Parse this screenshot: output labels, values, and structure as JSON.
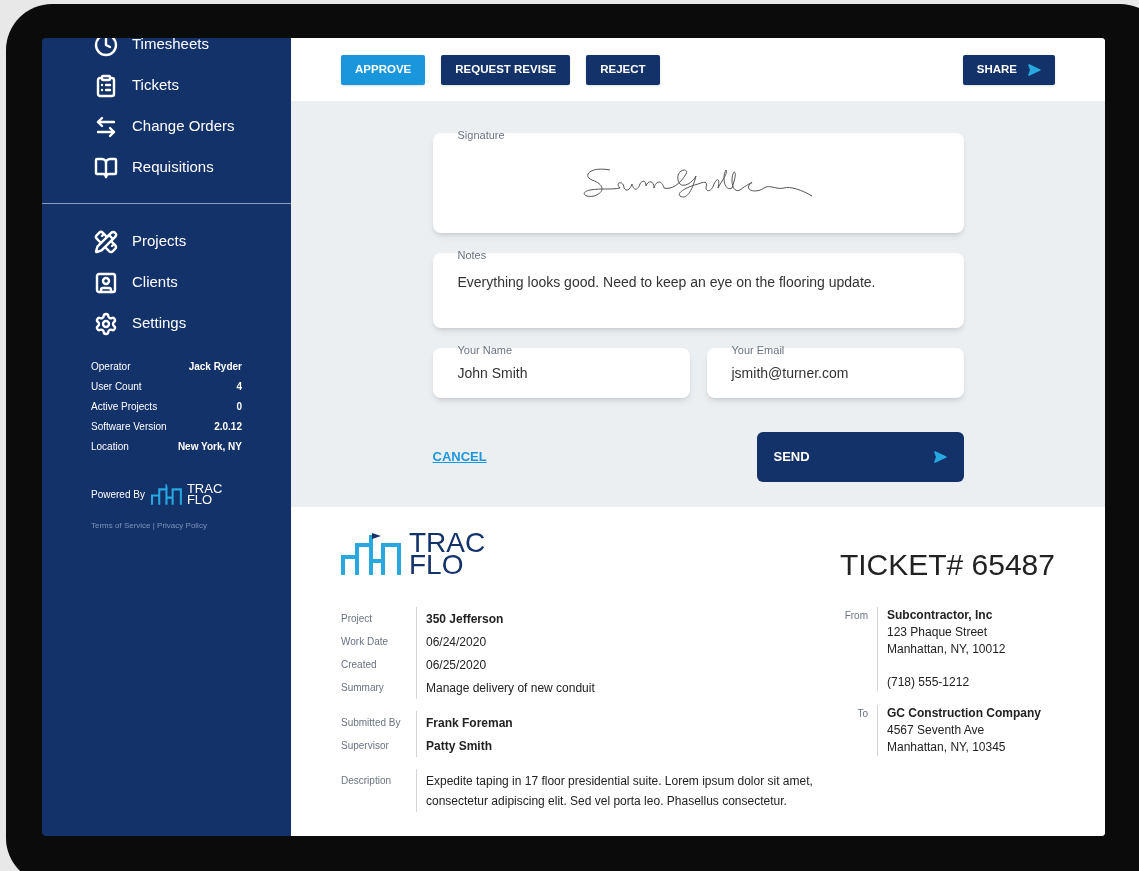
{
  "sidebar": {
    "nav_top": [
      {
        "kind": "timesheets",
        "label": "Timesheets"
      },
      {
        "kind": "tickets",
        "label": "Tickets"
      },
      {
        "kind": "change_orders",
        "label": "Change Orders"
      },
      {
        "kind": "requisitions",
        "label": "Requisitions"
      }
    ],
    "nav_bottom": [
      {
        "kind": "projects",
        "label": "Projects"
      },
      {
        "kind": "clients",
        "label": "Clients"
      },
      {
        "kind": "settings",
        "label": "Settings"
      }
    ],
    "info": [
      {
        "label": "Operator",
        "value": "Jack Ryder"
      },
      {
        "label": "User Count",
        "value": "4"
      },
      {
        "label": "Active Projects",
        "value": "0"
      },
      {
        "label": "Software Version",
        "value": "2.0.12"
      },
      {
        "label": "Location",
        "value": "New York, NY"
      }
    ],
    "powered_by": "Powered By",
    "logo_line1": "TRAC",
    "logo_line2": "FLO",
    "terms": "Terms of Service | Privacy Policy"
  },
  "toolbar": {
    "buttons": [
      {
        "label": "APPROVE",
        "kind": "primary"
      },
      {
        "label": "REQUEST REVISE",
        "kind": "dark"
      },
      {
        "label": "REJECT",
        "kind": "dark"
      }
    ],
    "share": "SHARE"
  },
  "form": {
    "signature_label": "Signature",
    "notes_label": "Notes",
    "notes": "Everything looks good. Need to keep an eye on the flooring update.",
    "name_label": "Your Name",
    "name": "John Smith",
    "email_label": "Your Email",
    "email": "jsmith@turner.com",
    "cancel": "CANCEL",
    "send": "SEND"
  },
  "ticket": {
    "logo_line1": "TRAC",
    "logo_line2": "FLO",
    "title": "TICKET# 65487",
    "groups": [
      [
        {
          "label": "Project",
          "value": "350 Jefferson",
          "bold": true
        },
        {
          "label": "Work Date",
          "value": "06/24/2020",
          "bold": false
        },
        {
          "label": "Created",
          "value": "06/25/2020",
          "bold": false
        },
        {
          "label": "Summary",
          "value": "Manage delivery of new conduit",
          "bold": false
        }
      ],
      [
        {
          "label": "Submitted By",
          "value": "Frank Foreman",
          "bold": true
        },
        {
          "label": "Supervisor",
          "value": "Patty Smith",
          "bold": true
        }
      ],
      [
        {
          "label": "Description",
          "value": "Expedite taping in 17 floor presidential suite. Lorem ipsum dolor sit amet, consectetur adipiscing elit. Sed vel porta leo. Phasellus consectetur.",
          "bold": false
        }
      ]
    ],
    "parties": [
      {
        "label": "From",
        "name": "Subcontractor, Inc",
        "lines": [
          "123 Phaque Street",
          "Manhattan, NY, 10012"
        ],
        "phone": "(718) 555-1212"
      },
      {
        "label": "To",
        "name": "GC Construction Company",
        "lines": [
          "4567 Seventh Ave",
          "Manhattan, NY, 10345"
        ]
      }
    ]
  }
}
